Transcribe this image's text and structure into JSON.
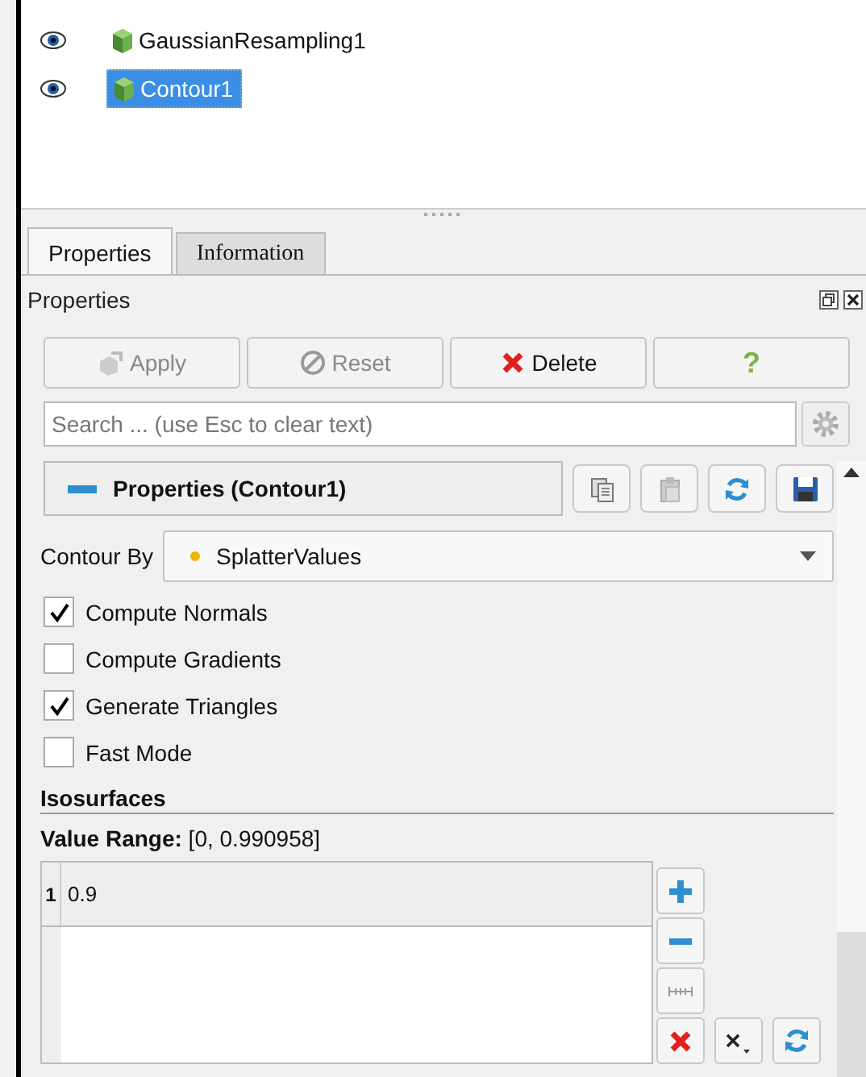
{
  "pipeline": [
    {
      "label": "GaussianResampling1",
      "visible": true,
      "selected": false
    },
    {
      "label": "Contour1",
      "visible": true,
      "selected": true
    }
  ],
  "tabs": [
    {
      "label": "Properties",
      "selected": true
    },
    {
      "label": "Information",
      "selected": false
    }
  ],
  "panel_title": "Properties",
  "buttons": [
    {
      "label": "Apply",
      "kind": "apply",
      "disabled": true
    },
    {
      "label": "Reset",
      "kind": "reset",
      "disabled": true
    },
    {
      "label": "Delete",
      "kind": "delete",
      "disabled": false
    },
    {
      "label": "?",
      "kind": "help",
      "disabled": false
    }
  ],
  "search": {
    "placeholder": "Search ... (use Esc to clear text)"
  },
  "section": {
    "title": "Properties (Contour1)",
    "expanded": true
  },
  "contour_by": {
    "label": "Contour By",
    "value": "SplatterValues"
  },
  "checkboxes": [
    {
      "label": "Compute Normals",
      "checked": true
    },
    {
      "label": "Compute Gradients",
      "checked": false
    },
    {
      "label": "Generate Triangles",
      "checked": true
    },
    {
      "label": "Fast Mode",
      "checked": false
    }
  ],
  "isosurfaces": {
    "title": "Isosurfaces",
    "range": "**Value Range:** [0, 0.990958]",
    "rows": [
      {
        "index": "1",
        "value": "0.9"
      }
    ]
  }
}
